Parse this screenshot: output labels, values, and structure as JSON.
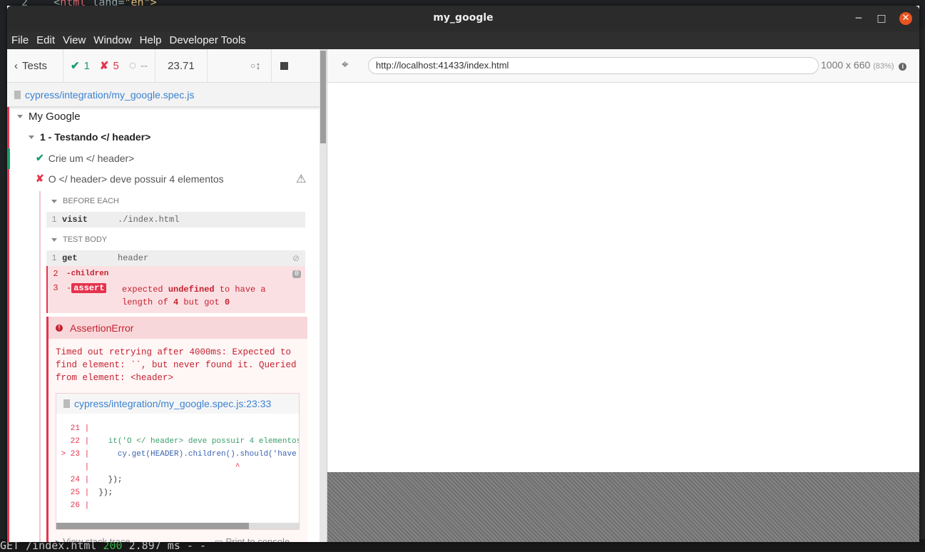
{
  "background": {
    "code_top_prefix": "2    <",
    "code_top_tag": "html",
    "code_top_attr": " lang=",
    "code_top_value": "\"en\">",
    "terminal_line_pre": "GET /index.html ",
    "terminal_status": "200",
    "terminal_line_post": " 2.897 ms - -"
  },
  "window": {
    "title": "my_google",
    "minimize_glyph": "─",
    "maximize_glyph": "□",
    "close_glyph": "✕"
  },
  "menu": [
    "File",
    "Edit",
    "View",
    "Window",
    "Help",
    "Developer Tools"
  ],
  "reporter": {
    "tests_label": "Tests",
    "passed_count": "1",
    "failed_count": "5",
    "pending_count": "--",
    "duration": "23.71",
    "spec_path": "cypress/integration/my_google.spec.js",
    "suite_title": "My Google",
    "subsuite_title": "1 - Testando </ header>",
    "test_passed_title": "Crie um </ header>",
    "test_failed_title": "O </ header> deve possuir 4 elementos",
    "before_each_label": "BEFORE EACH",
    "test_body_label": "TEST BODY",
    "commands_before": [
      {
        "num": "1",
        "name": "visit",
        "message": "./index.html"
      }
    ],
    "commands_body": [
      {
        "num": "1",
        "name": "get",
        "message": "header"
      },
      {
        "num": "2",
        "name": "-children",
        "badge": "0"
      },
      {
        "num": "3",
        "name": "assert",
        "message_parts": [
          "expected ",
          "undefined",
          " to have a",
          "length of ",
          "4",
          " but got ",
          "0"
        ]
      }
    ],
    "error": {
      "title": "AssertionError",
      "message": "Timed out retrying after 4000ms: Expected to\nfind element: ``, but never found it. Queried\nfrom element: <header>",
      "frame_path": "cypress/integration/my_google.spec.js:23:33",
      "code_lines": [
        {
          "ln": "   21",
          "sep": " |",
          "code": ""
        },
        {
          "ln": "   22",
          "sep": " |",
          "code": "    it('O </ header> deve possuir 4 elementos'"
        },
        {
          "ln": " > 23",
          "sep": " |",
          "code": "      cy.get(HEADER).children().should('have"
        },
        {
          "ln": "     ",
          "sep": " |",
          "code": "                               ^"
        },
        {
          "ln": "   24",
          "sep": " |",
          "code": "    });"
        },
        {
          "ln": "   25",
          "sep": " |",
          "code": "  });"
        },
        {
          "ln": "   26",
          "sep": " |",
          "code": ""
        }
      ],
      "view_stack_trace": "View stack trace",
      "print_to_console": "Print to console"
    }
  },
  "aut": {
    "url": "http://localhost:41433/index.html",
    "viewport": "1000 x 660",
    "scale": "(83%)"
  },
  "colors": {
    "pass": "#1a9e6b",
    "fail": "#e5334d",
    "link": "#3b82d1"
  }
}
